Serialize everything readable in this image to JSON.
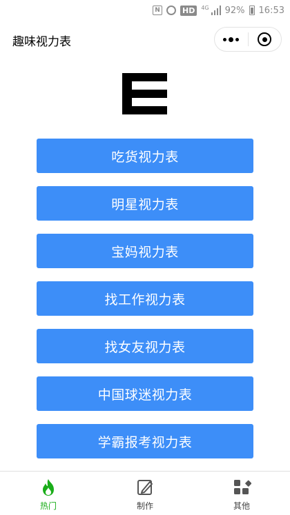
{
  "status_bar": {
    "nfc": "N",
    "hd": "HD",
    "network": "4G",
    "battery": "92%",
    "time": "16:53"
  },
  "header": {
    "title": "趣味视力表"
  },
  "optotype": {
    "glyph": "E",
    "orientation": "right"
  },
  "buttons": [
    {
      "label": "吃货视力表"
    },
    {
      "label": "明星视力表"
    },
    {
      "label": "宝妈视力表"
    },
    {
      "label": "找工作视力表"
    },
    {
      "label": "找女友视力表"
    },
    {
      "label": "中国球迷视力表"
    },
    {
      "label": "学霸报考视力表"
    }
  ],
  "tabs": [
    {
      "label": "热门",
      "icon": "flame-icon",
      "active": true
    },
    {
      "label": "制作",
      "icon": "edit-icon",
      "active": false
    },
    {
      "label": "其他",
      "icon": "grid-icon",
      "active": false
    }
  ],
  "colors": {
    "button_blue": "#3d8ef8",
    "active_green": "#1aad19",
    "inactive_gray": "#444444"
  }
}
